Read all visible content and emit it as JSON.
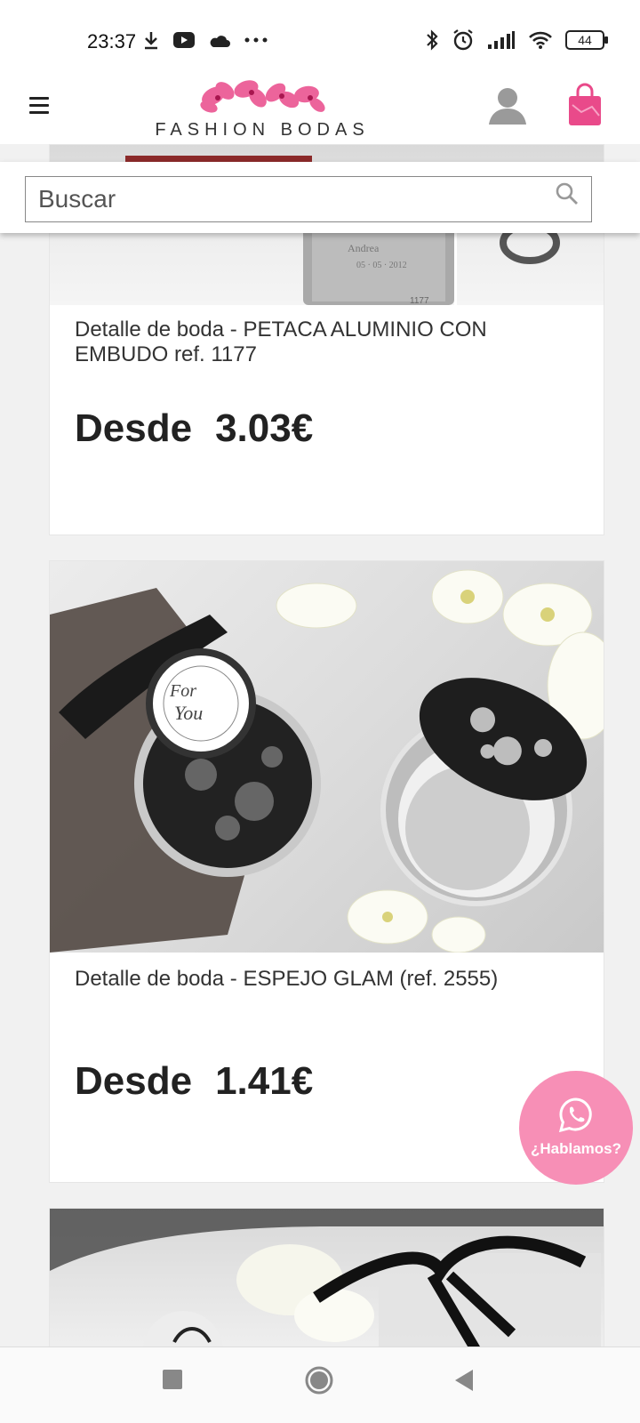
{
  "status_bar": {
    "time": "23:37",
    "battery": "44",
    "icons": [
      "download-icon",
      "youtube-icon",
      "cloud-icon",
      "more-icon",
      "bluetooth-icon",
      "alarm-icon",
      "signal-icon",
      "wifi-icon",
      "battery-icon"
    ]
  },
  "header": {
    "logo_text": "FASHION BODAS",
    "menu_icon": "hamburger-icon",
    "user_icon": "user-icon",
    "cart_icon": "shopping-bag-icon"
  },
  "search": {
    "placeholder": "Buscar",
    "icon": "search-icon"
  },
  "products": [
    {
      "title": "Detalle de boda - PETACA ALUMINIO CON EMBUDO ref. 1177",
      "price_prefix": "Desde",
      "price": "3.03€"
    },
    {
      "title": "Detalle de boda - ESPEJO GLAM (ref. 2555)",
      "price_prefix": "Desde",
      "price": "1.41€"
    }
  ],
  "whatsapp": {
    "label": "¿Hablamos?",
    "icon": "whatsapp-icon"
  },
  "colors": {
    "brand_pink": "#e94a8a",
    "fab_pink": "#f78fb6"
  }
}
